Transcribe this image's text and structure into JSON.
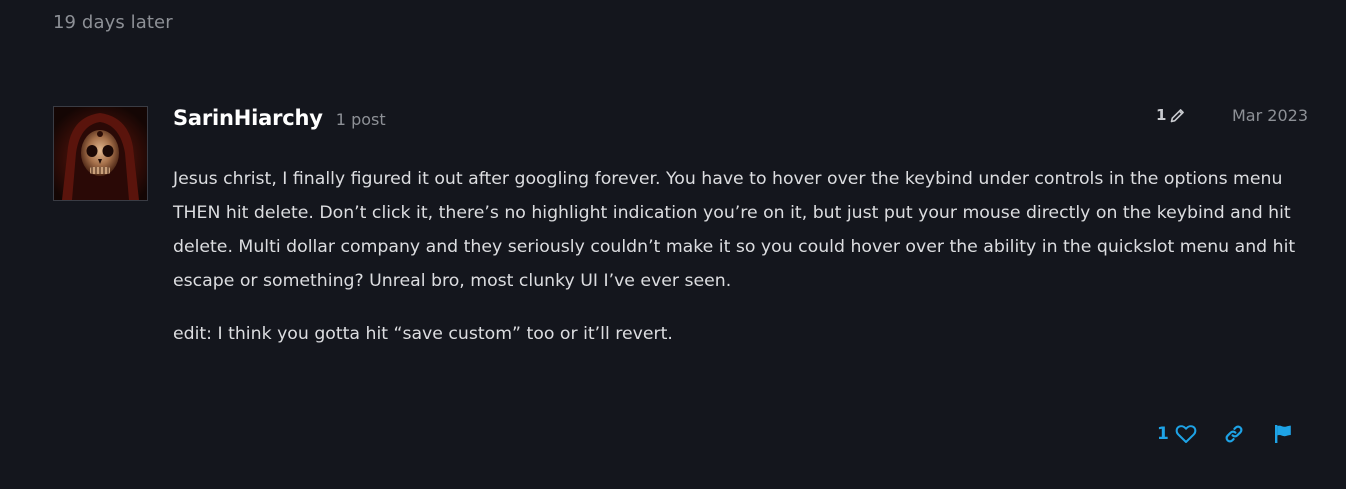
{
  "time_gap": {
    "label": "19 days later"
  },
  "post": {
    "username": "SarinHiarchy",
    "post_count": "1 post",
    "edit_count": "1",
    "date": "Mar 2023",
    "paragraphs": [
      "Jesus christ, I finally figured it out after googling forever. You have to hover over the keybind under controls in the options menu THEN hit delete. Don’t click it, there’s no highlight indication you’re on it, but just put your mouse directly on the keybind and hit delete. Multi dollar company and they seriously couldn’t make it so you could hover over the ability in the quickslot menu and hit escape or something? Unreal bro, most clunky UI I’ve ever seen.",
      "edit: I think you gotta hit “save custom” too or it’ll revert."
    ],
    "like_count": "1"
  },
  "icons": {
    "edit": "pencil-icon",
    "like": "heart-icon",
    "link": "link-icon",
    "flag": "flag-icon"
  },
  "colors": {
    "background": "#14161d",
    "accent": "#1ea3e6",
    "text": "#dcdde0",
    "muted": "#8d9096"
  }
}
